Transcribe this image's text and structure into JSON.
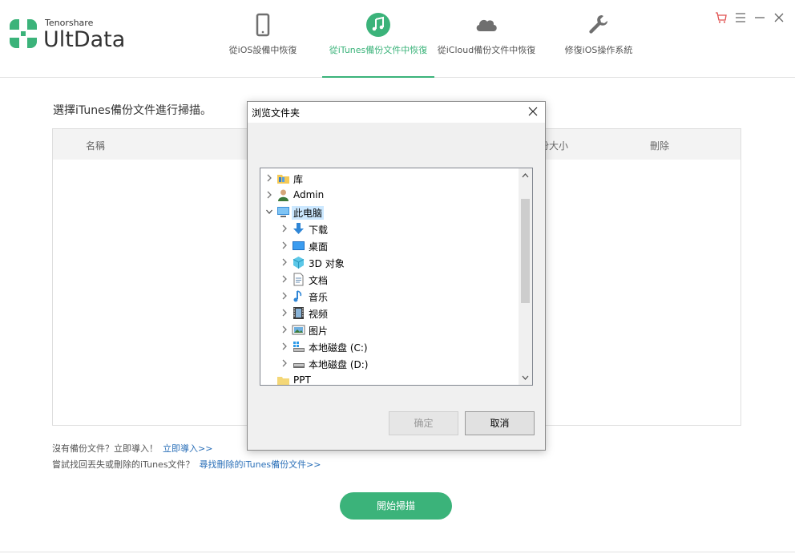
{
  "header": {
    "brand_small": "Tenorshare",
    "brand_name": "UltData",
    "tabs": [
      {
        "label": "從iOS設備中恢復",
        "icon": "phone-icon",
        "active": false
      },
      {
        "label": "從iTunes備份文件中恢復",
        "icon": "music-note-icon",
        "active": true
      },
      {
        "label": "從iCloud備份文件中恢復",
        "icon": "cloud-icon",
        "active": false
      },
      {
        "label": "修復iOS操作系統",
        "icon": "wrench-icon",
        "active": false
      }
    ],
    "controls": [
      "cart-icon",
      "menu-icon",
      "minimize-icon",
      "close-icon"
    ]
  },
  "main": {
    "instruction": "選擇iTunes備份文件進行掃描。",
    "columns": [
      "名稱",
      "備份大小",
      "刪除"
    ],
    "note1_text": "沒有備份文件？立即導入！",
    "note1_link": "立即導入>>",
    "note2_text": "嘗試找回丟失或刪除的iTunes文件？",
    "note2_link": "尋找刪除的iTunes備份文件>>",
    "scan_button": "開始掃描"
  },
  "dialog": {
    "title": "浏览文件夹",
    "items": [
      {
        "label": "库",
        "icon": "library-folder-icon",
        "level": 0,
        "expanded": false,
        "selected": false
      },
      {
        "label": "Admin",
        "icon": "user-icon",
        "level": 0,
        "expanded": false,
        "selected": false
      },
      {
        "label": "此电脑",
        "icon": "computer-icon",
        "level": 0,
        "expanded": true,
        "selected": true
      },
      {
        "label": "下载",
        "icon": "download-icon",
        "level": 1,
        "expanded": false,
        "selected": false
      },
      {
        "label": "桌面",
        "icon": "desktop-icon",
        "level": 1,
        "expanded": false,
        "selected": false
      },
      {
        "label": "3D 对象",
        "icon": "3d-objects-icon",
        "level": 1,
        "expanded": false,
        "selected": false
      },
      {
        "label": "文档",
        "icon": "document-icon",
        "level": 1,
        "expanded": false,
        "selected": false
      },
      {
        "label": "音乐",
        "icon": "music-icon",
        "level": 1,
        "expanded": false,
        "selected": false
      },
      {
        "label": "视频",
        "icon": "video-icon",
        "level": 1,
        "expanded": false,
        "selected": false
      },
      {
        "label": "图片",
        "icon": "picture-icon",
        "level": 1,
        "expanded": false,
        "selected": false
      },
      {
        "label": "本地磁盘 (C:)",
        "icon": "windows-drive-icon",
        "level": 1,
        "expanded": false,
        "selected": false
      },
      {
        "label": "本地磁盘 (D:)",
        "icon": "drive-icon",
        "level": 1,
        "expanded": false,
        "selected": false
      },
      {
        "label": "PPT",
        "icon": "folder-icon",
        "level": 0,
        "expanded": null,
        "selected": false
      }
    ],
    "ok_button": "确定",
    "cancel_button": "取消"
  },
  "colors": {
    "accent": "#3bb37a",
    "link": "#2a6fb8",
    "selection": "#cce8ff"
  }
}
